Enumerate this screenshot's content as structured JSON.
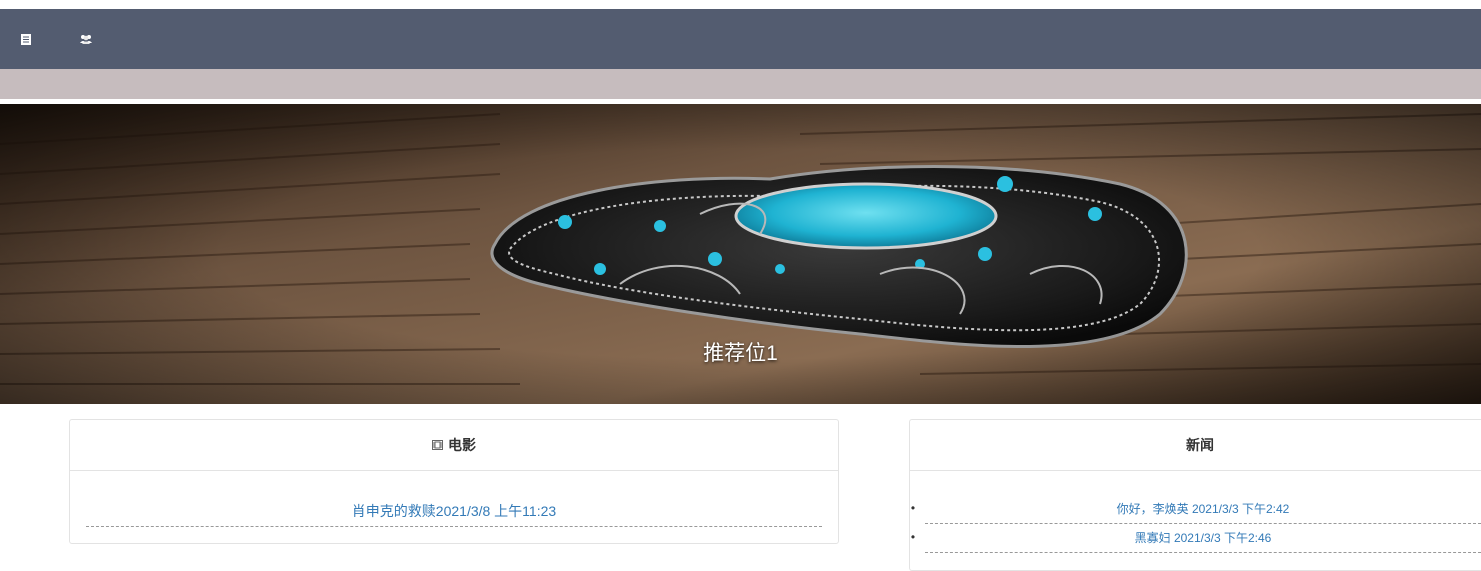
{
  "navbar": {
    "icons": [
      "book-icon",
      "users-icon"
    ]
  },
  "banner": {
    "caption": "推荐位1"
  },
  "movies": {
    "title": "电影",
    "title_icon": "film-icon",
    "items": [
      {
        "text": "肖申克的救赎2021/3/8 上午11:23"
      }
    ]
  },
  "news": {
    "title": "新闻",
    "items": [
      {
        "text": "你好，李焕英 2021/3/3 下午2:42"
      },
      {
        "text": "黑寡妇 2021/3/3 下午2:46"
      }
    ]
  },
  "colors": {
    "navbar": "#535c70",
    "subbar": "#c6bcbe",
    "link": "#337ab7"
  }
}
